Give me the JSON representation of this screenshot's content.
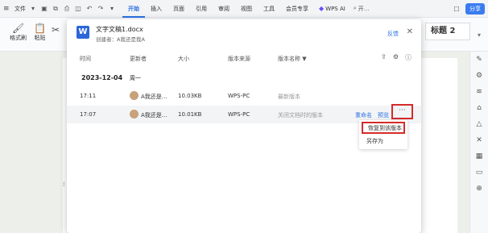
{
  "topbar": {
    "file_label": "文件",
    "tabs": [
      "开始",
      "插入",
      "页面",
      "引用",
      "审阅",
      "视图",
      "工具",
      "会员专享"
    ],
    "ai_label": "WPS AI",
    "search_label": "开...",
    "share_label": "分享"
  },
  "ribbon": {
    "format_painter": "格式刷",
    "paste": "粘贴",
    "heading": "标题 2"
  },
  "dialog": {
    "word_icon": "W",
    "title": "文字文稿1.docx",
    "creator": "创建者：A我还是我A",
    "feedback": "反馈",
    "close": "✕",
    "columns": {
      "time": "时间",
      "updater": "更新者",
      "size": "大小",
      "source": "版本来源",
      "name": "版本名称"
    },
    "date_header": "2023-12-04",
    "weekday": "周一",
    "rows": [
      {
        "time": "17:11",
        "updater": "A我还是...",
        "size": "10.03KB",
        "source": "WPS-PC",
        "name": "最新版本"
      },
      {
        "time": "17:07",
        "updater": "A我还是...",
        "size": "10.01KB",
        "source": "WPS-PC",
        "name": "关闭文档时的版本",
        "rename": "重命名",
        "preview": "预览",
        "more": "···"
      }
    ],
    "menu": {
      "restore": "恢复到该版本",
      "save_as": "另存为"
    }
  }
}
